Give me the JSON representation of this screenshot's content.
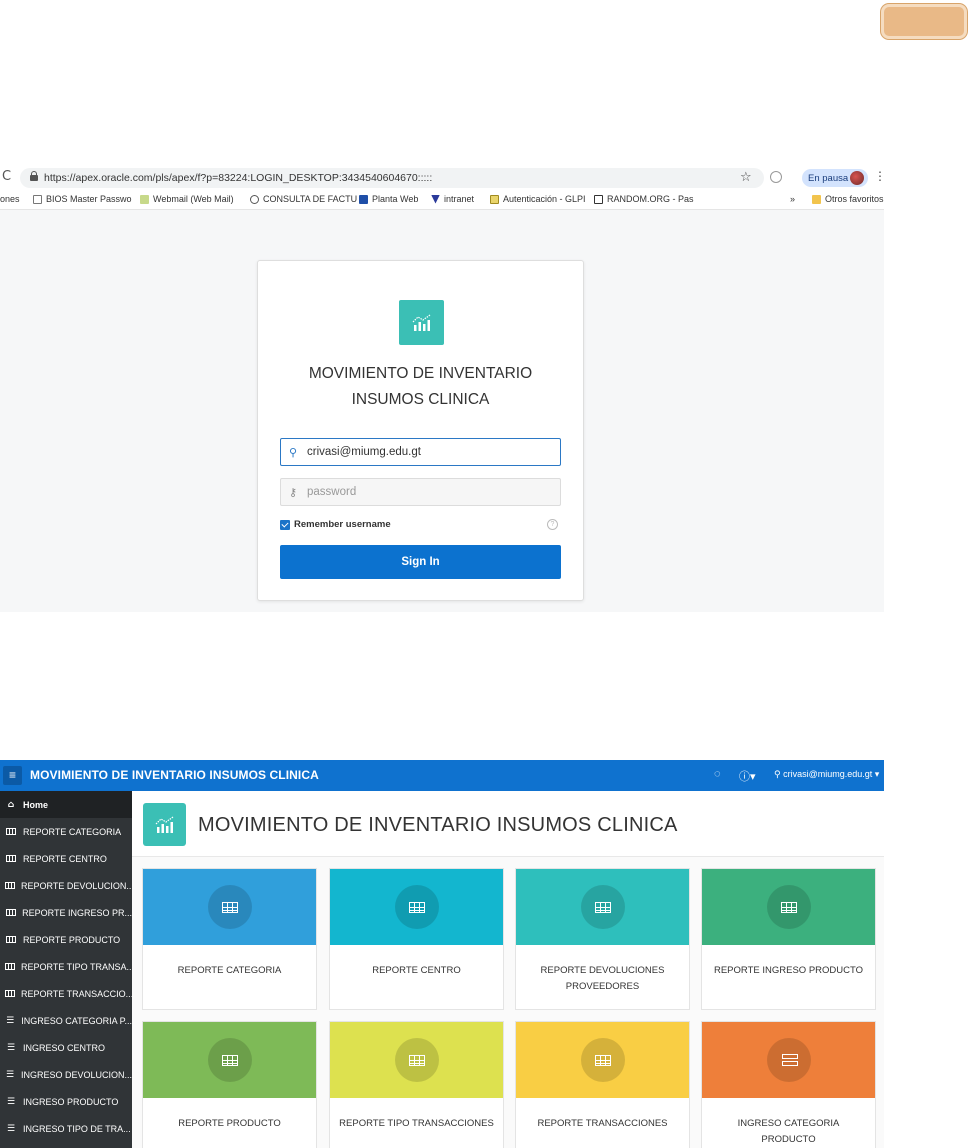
{
  "colors": {
    "apex_blue": "#0f72cf",
    "logo_teal": "#3bbfb5",
    "sidebar": "#303437",
    "tile_blue": "#309fdb",
    "tile_cyan": "#13b6cf",
    "tile_teal": "#2ebfbc",
    "tile_green": "#3cb07e",
    "tile_lightgreen": "#7eba57",
    "tile_yellowgreen": "#dde14f",
    "tile_yellow": "#f9ce44",
    "tile_orange": "#ee7f3a"
  },
  "browser": {
    "url": "https://apex.oracle.com/pls/apex/f?p=83224:LOGIN_DESKTOP:3434540604670:::::",
    "pause_label": "En pausa",
    "bookmarks": [
      {
        "label": "iones"
      },
      {
        "label": "BIOS Master Passwo"
      },
      {
        "label": "Webmail (Web Mail)"
      },
      {
        "label": "CONSULTA DE FACTU"
      },
      {
        "label": "Planta Web"
      },
      {
        "label": "intranet"
      },
      {
        "label": "Autenticación - GLPI"
      },
      {
        "label": "RANDOM.ORG - Pas"
      },
      {
        "label": "»"
      },
      {
        "label": "Otros favoritos"
      }
    ]
  },
  "login": {
    "title_line1": "MOVIMIENTO DE INVENTARIO",
    "title_line2": "INSUMOS CLINICA",
    "username_value": "crivasi@miumg.edu.gt",
    "password_placeholder": "password",
    "remember_label": "Remember username",
    "help_glyph": "?",
    "signin_label": "Sign In"
  },
  "apex": {
    "app_name": "MOVIMIENTO DE INVENTARIO INSUMOS CLINICA",
    "user_label": "crivasi@miumg.edu.gt",
    "page_title": "MOVIMIENTO DE INVENTARIO INSUMOS CLINICA",
    "sidebar": [
      {
        "label": "Home",
        "icon": "home-icon"
      },
      {
        "label": "REPORTE CATEGORIA",
        "icon": "grid-icon"
      },
      {
        "label": "REPORTE CENTRO",
        "icon": "grid-icon"
      },
      {
        "label": "REPORTE DEVOLUCION...",
        "icon": "grid-icon"
      },
      {
        "label": "REPORTE INGRESO PR...",
        "icon": "grid-icon"
      },
      {
        "label": "REPORTE PRODUCTO",
        "icon": "grid-icon"
      },
      {
        "label": "REPORTE TIPO TRANSA...",
        "icon": "grid-icon"
      },
      {
        "label": "REPORTE TRANSACCIO...",
        "icon": "grid-icon"
      },
      {
        "label": "INGRESO CATEGORIA P...",
        "icon": "form-icon"
      },
      {
        "label": "INGRESO CENTRO",
        "icon": "form-icon"
      },
      {
        "label": "INGRESO DEVOLUCION...",
        "icon": "form-icon"
      },
      {
        "label": "INGRESO PRODUCTO",
        "icon": "form-icon"
      },
      {
        "label": "INGRESO TIPO DE TRA...",
        "icon": "form-icon"
      }
    ],
    "tiles": [
      {
        "label": "REPORTE CATEGORIA",
        "icon": "grid-icon"
      },
      {
        "label": "REPORTE CENTRO",
        "icon": "grid-icon"
      },
      {
        "label": "REPORTE DEVOLUCIONES PROVEEDORES",
        "icon": "grid-icon"
      },
      {
        "label": "REPORTE INGRESO PRODUCTO",
        "icon": "grid-icon"
      },
      {
        "label": "REPORTE PRODUCTO",
        "icon": "grid-icon"
      },
      {
        "label": "REPORTE TIPO TRANSACCIONES",
        "icon": "grid-icon"
      },
      {
        "label": "REPORTE TRANSACCIONES",
        "icon": "grid-icon"
      },
      {
        "label": "INGRESO CATEGORIA PRODUCTO",
        "icon": "form-icon"
      }
    ]
  }
}
